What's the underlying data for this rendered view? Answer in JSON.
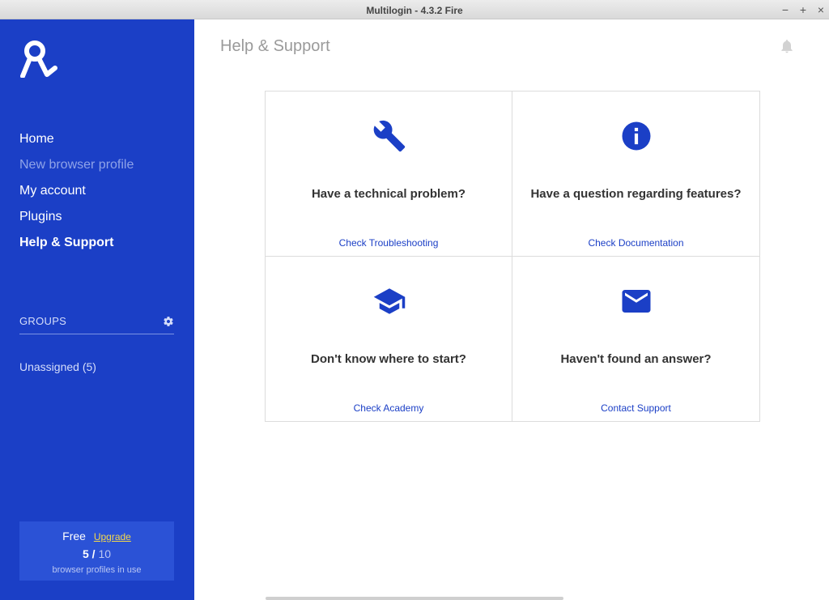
{
  "window": {
    "title": "Multilogin - 4.3.2 Fire",
    "controls": [
      "−",
      "+",
      "×"
    ]
  },
  "sidebar": {
    "logo_icon": "multilogin-logo-icon",
    "nav": [
      {
        "label": "Home",
        "state": "normal"
      },
      {
        "label": "New browser profile",
        "state": "disabled"
      },
      {
        "label": "My account",
        "state": "normal"
      },
      {
        "label": "Plugins",
        "state": "normal"
      },
      {
        "label": "Help & Support",
        "state": "active"
      }
    ],
    "groups_title": "GROUPS",
    "groups": [
      {
        "label": "Unassigned (5)"
      }
    ],
    "plan": {
      "name": "Free",
      "upgrade_label": "Upgrade",
      "used": "5 /",
      "limit": "10",
      "caption": "browser profiles in use"
    }
  },
  "main": {
    "page_title": "Help & Support",
    "cards": [
      {
        "icon": "wrench-icon",
        "question": "Have a technical problem?",
        "link": "Check Troubleshooting"
      },
      {
        "icon": "info-icon",
        "question": "Have a question regarding features?",
        "link": "Check Documentation"
      },
      {
        "icon": "graduation-cap-icon",
        "question": "Don't know where to start?",
        "link": "Check Academy"
      },
      {
        "icon": "envelope-icon",
        "question": "Haven't found an answer?",
        "link": "Contact Support"
      }
    ]
  },
  "colors": {
    "sidebar_bg": "#1b3fc6",
    "accent": "#1b3fc6",
    "upgrade": "#f3d84b"
  }
}
